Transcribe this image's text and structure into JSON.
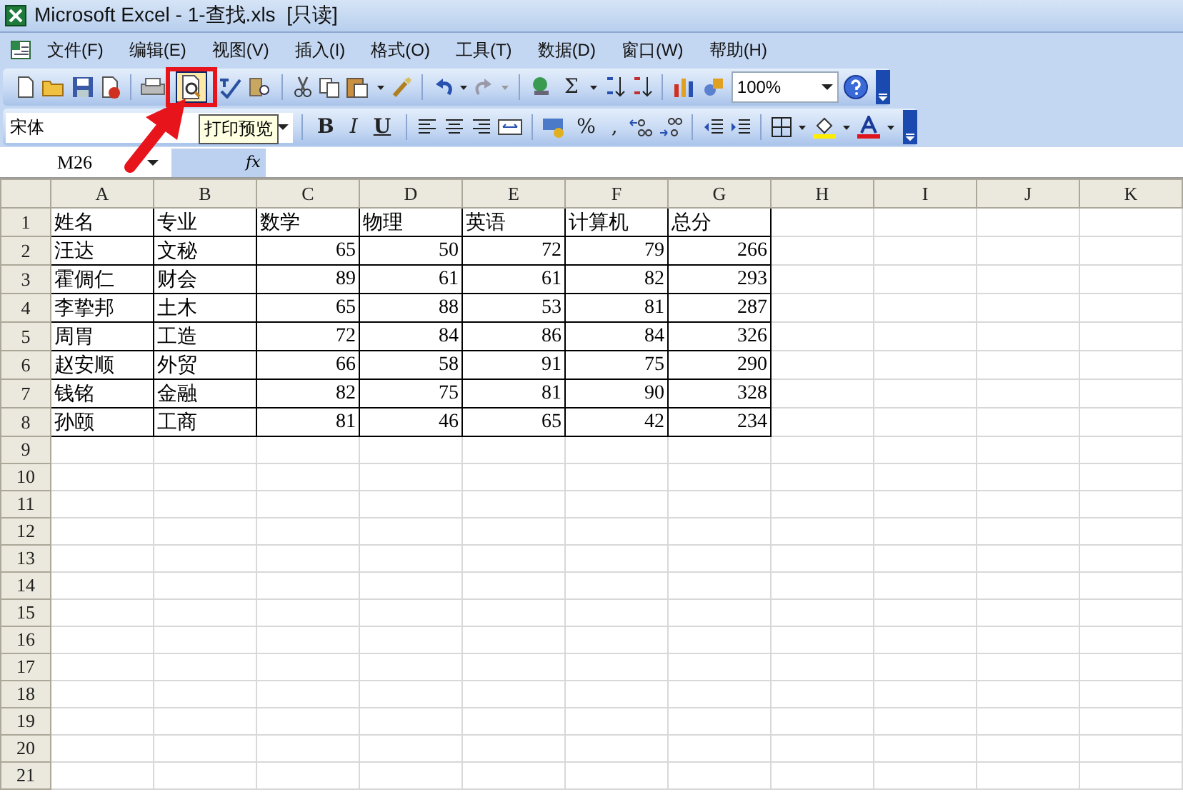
{
  "window": {
    "title": "Microsoft Excel - 1-查找.xls  [只读]"
  },
  "menu": [
    {
      "label": "文件(F)"
    },
    {
      "label": "编辑(E)"
    },
    {
      "label": "视图(V)"
    },
    {
      "label": "插入(I)"
    },
    {
      "label": "格式(O)"
    },
    {
      "label": "工具(T)"
    },
    {
      "label": "数据(D)"
    },
    {
      "label": "窗口(W)"
    },
    {
      "label": "帮助(H)"
    }
  ],
  "standard_toolbar": {
    "sum": "Σ",
    "zoom": "100%",
    "tooltip": "打印预览"
  },
  "formatting_toolbar": {
    "font": "宋体",
    "bold": "B",
    "italic": "I",
    "underline": "U",
    "percent": "%",
    "comma": ","
  },
  "formula_bar": {
    "name_box": "M26",
    "function_label": "fx"
  },
  "sheet": {
    "columns": [
      "A",
      "B",
      "C",
      "D",
      "E",
      "F",
      "G",
      "H",
      "I",
      "J",
      "K"
    ],
    "rows": [
      {
        "header": "1",
        "kind": "header",
        "cells": [
          "姓名",
          "专业",
          "数学",
          "物理",
          "英语",
          "计算机",
          "总分"
        ]
      },
      {
        "header": "2",
        "kind": "data",
        "cells": [
          "汪达",
          "文秘",
          "65",
          "50",
          "72",
          "79",
          "266"
        ]
      },
      {
        "header": "3",
        "kind": "data",
        "cells": [
          "霍倜仁",
          "财会",
          "89",
          "61",
          "61",
          "82",
          "293"
        ]
      },
      {
        "header": "4",
        "kind": "data",
        "cells": [
          "李挚邦",
          "土木",
          "65",
          "88",
          "53",
          "81",
          "287"
        ]
      },
      {
        "header": "5",
        "kind": "data",
        "cells": [
          "周胃",
          "工造",
          "72",
          "84",
          "86",
          "84",
          "326"
        ]
      },
      {
        "header": "6",
        "kind": "data",
        "cells": [
          "赵安顺",
          "外贸",
          "66",
          "58",
          "91",
          "75",
          "290"
        ]
      },
      {
        "header": "7",
        "kind": "data",
        "cells": [
          "钱铭",
          "金融",
          "82",
          "75",
          "81",
          "90",
          "328"
        ]
      },
      {
        "header": "8",
        "kind": "data",
        "cells": [
          "孙颐",
          "工商",
          "81",
          "46",
          "65",
          "42",
          "234"
        ]
      },
      {
        "header": "9",
        "kind": "empty"
      },
      {
        "header": "10",
        "kind": "empty"
      },
      {
        "header": "11",
        "kind": "empty"
      },
      {
        "header": "12",
        "kind": "empty"
      },
      {
        "header": "13",
        "kind": "empty"
      },
      {
        "header": "14",
        "kind": "empty"
      },
      {
        "header": "15",
        "kind": "empty"
      },
      {
        "header": "16",
        "kind": "empty"
      },
      {
        "header": "17",
        "kind": "empty"
      },
      {
        "header": "18",
        "kind": "empty"
      },
      {
        "header": "19",
        "kind": "empty"
      },
      {
        "header": "20",
        "kind": "empty"
      },
      {
        "header": "21",
        "kind": "empty"
      }
    ]
  }
}
